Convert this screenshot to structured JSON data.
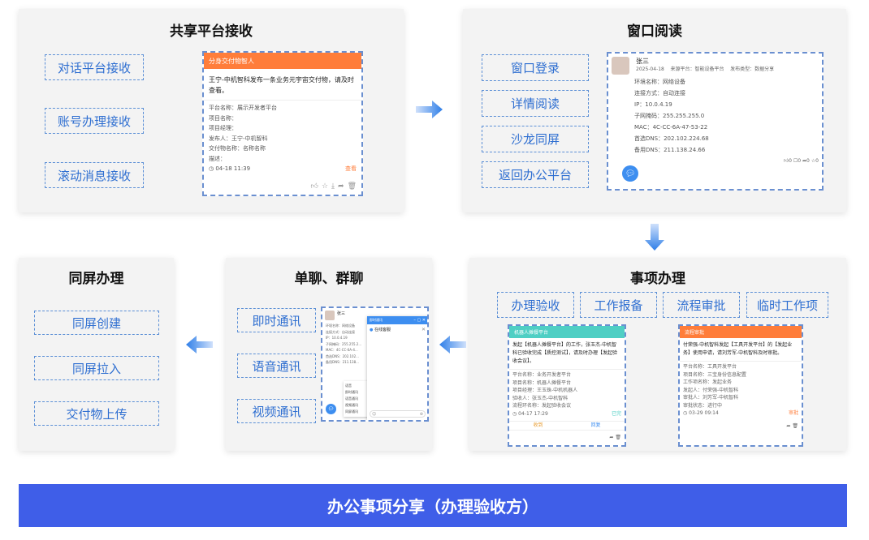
{
  "panel1": {
    "title": "共享平台接收",
    "buttons": [
      "对话平台接收",
      "账号办理接收",
      "滚动消息接收"
    ],
    "card": {
      "header": "分身交付物智人",
      "message": "王宁-中机智科发布一条业务元宇宙交付物，请及时查看。",
      "fields": [
        "平台名称：展示开发者平台",
        "项目名称：",
        "项目经理：",
        "发布人：王宁-中机智科",
        "交付物名称：名称名称",
        "描述："
      ],
      "time": "04-18 11:39",
      "action": "查看"
    }
  },
  "panel2": {
    "title": "窗口阅读",
    "buttons": [
      "窗口登录",
      "详情阅读",
      "沙龙同屏",
      "返回办公平台"
    ],
    "card": {
      "name": "张三",
      "date": "2025-04-18",
      "source": "来源平台：智能设备平台",
      "type": "发布类型：数据分享",
      "fields": [
        "环境名称：网络设备",
        "连接方式：自动连接",
        "IP：10.0.4.19",
        "子网掩码：255.255.255.0",
        "MAC：4C-CC-6A-47-53-22",
        "首选DNS：202.102.224.68",
        "备用DNS：211.138.24.66"
      ],
      "stats": [
        "0",
        "0",
        "0",
        "0"
      ]
    }
  },
  "panel3": {
    "title": "事项办理",
    "buttons": [
      "办理验收",
      "工作报备",
      "流程审批",
      "临时工作项"
    ],
    "card1": {
      "header": "机器人摊餐平台",
      "message": "发起【机器人摊餐平台】的工作，张玉杰-中机智科已验收完成【质控测试】，请及时办理【发起验收会议】。",
      "fields": [
        "平台名称：业务开发者平台",
        "项目名称：机器人摊餐平台",
        "项目经理：王玉珠-中机机器人",
        "验收人：张玉杰-中机智科",
        "流程环名称：发起验收会议"
      ],
      "time": "04-17 17:29",
      "status": "已完",
      "actions": [
        "收到",
        "回复"
      ]
    },
    "card2": {
      "header": "流程审批",
      "message": "付荣强-中机智科发起【工具开发平台】的【发起业务】使用申请，请刘芳军-中机智科及时审批。",
      "fields": [
        "平台名称：工具开发平台",
        "项目名称：三宝身份信息配置",
        "工作项名称：发起业务",
        "发起人：付荣强-中机智科",
        "审批人：刘芳军-中机智科",
        "审批状态：进行中"
      ],
      "time": "03-29 09:14",
      "status": "审批"
    }
  },
  "panel4": {
    "title": "单聊、群聊",
    "buttons": [
      "即时通讯",
      "语音通讯",
      "视频通讯"
    ],
    "card": {
      "name": "张三",
      "popup_header": "即时通讯",
      "popup_title": "在线客服",
      "fields": [
        "环境名称：网络设备",
        "连接方式：自动连接",
        "IP：10.0.4.19",
        "子网掩码：255.255.2...",
        "MAC：4C-CC-6A-4...",
        "首选DNS：202.102...",
        "备用DNS：211.138..."
      ],
      "menu": [
        "语音",
        "即时通讯",
        "语音通讯",
        "视频通讯",
        "同屏通讯"
      ]
    }
  },
  "panel5": {
    "title": "同屏办理",
    "buttons": [
      "同屏创建",
      "同屏拉入",
      "交付物上传"
    ]
  },
  "footer": {
    "title": "办公事项分享（办理验收方）"
  },
  "colors": {
    "accent": "#3f5ee8",
    "orange": "#ff7d3a",
    "teal": "#4fcfc4",
    "dashed": "#5b8fd6",
    "arrow": "#2f7fe8"
  }
}
